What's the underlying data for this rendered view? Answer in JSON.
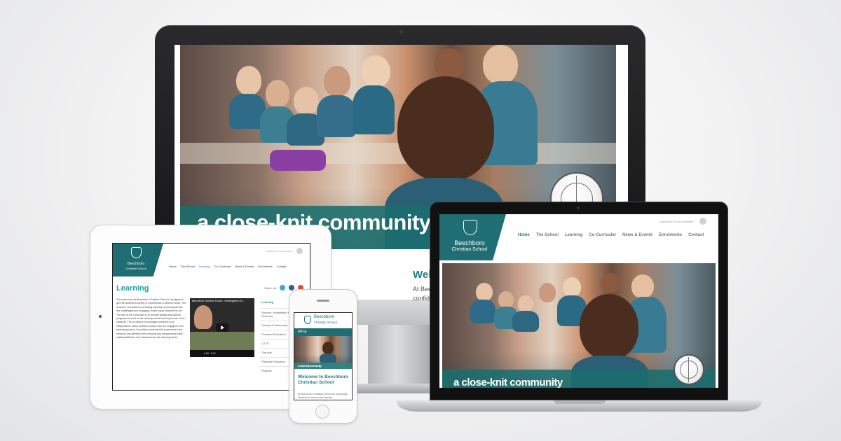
{
  "site": {
    "school_name_line1": "Beechboro",
    "school_name_line2": "Christian School",
    "banner_text": "a close-knit community",
    "subscribe_text": "Subscribe to our newsletter",
    "nav": [
      "Home",
      "The School",
      "Learning",
      "Co-Curricular",
      "News & Events",
      "Enrolments",
      "Contact"
    ],
    "nav_active": "Home"
  },
  "desktop": {
    "welcome_heading": "Welc",
    "welcome_text_1": "At Beec",
    "welcome_text_2": "confide"
  },
  "tablet": {
    "nav_active": "Learning",
    "page_title": "Learning",
    "share_label": "Share via:",
    "paragraph": "The curriculum at Beechboro Christian School is designed to give all students a variety of experiences in diverse areas. The school is committed to providing learning environments that are challenging and engaging, which equip students for life. The aim of the curriculum is to provide quality educational programmes built on the developmental learning needs of the students. The curriculum encourages students to be independent, active problem solvers who are engaged in the learning process. It provides students with experiences that enhance and develop their personal and interpersonal skills, spiritual attitudes and values across the learning areas.",
    "video_title": "Beechboro Christian School - Kindergarten Ori...",
    "video_time": "0:00 / 0:00",
    "side_menu": [
      "Learning",
      "Science, Humanities & Social Sciences",
      "Literacy & Numeracy",
      "Christian Education",
      "LOTE",
      "The Arts",
      "Physical Education",
      "Projects"
    ]
  },
  "phone": {
    "menu_label": "Menu",
    "banner_text": "a close-knit community",
    "welcome_heading": "Welcome to Beechboro Christian School",
    "welcome_text": "At Beechboro Christian School we encourage students to discover the diverse..."
  },
  "colors": {
    "brand_teal": "#1f6e73",
    "accent_teal": "#1c7f86",
    "heading_teal": "#1ca1ad"
  },
  "icons": [
    "camera-icon",
    "globe-icon",
    "play-icon",
    "twitter-icon",
    "facebook-icon",
    "google-plus-icon",
    "email-icon",
    "home-button-icon",
    "crest-icon"
  ]
}
